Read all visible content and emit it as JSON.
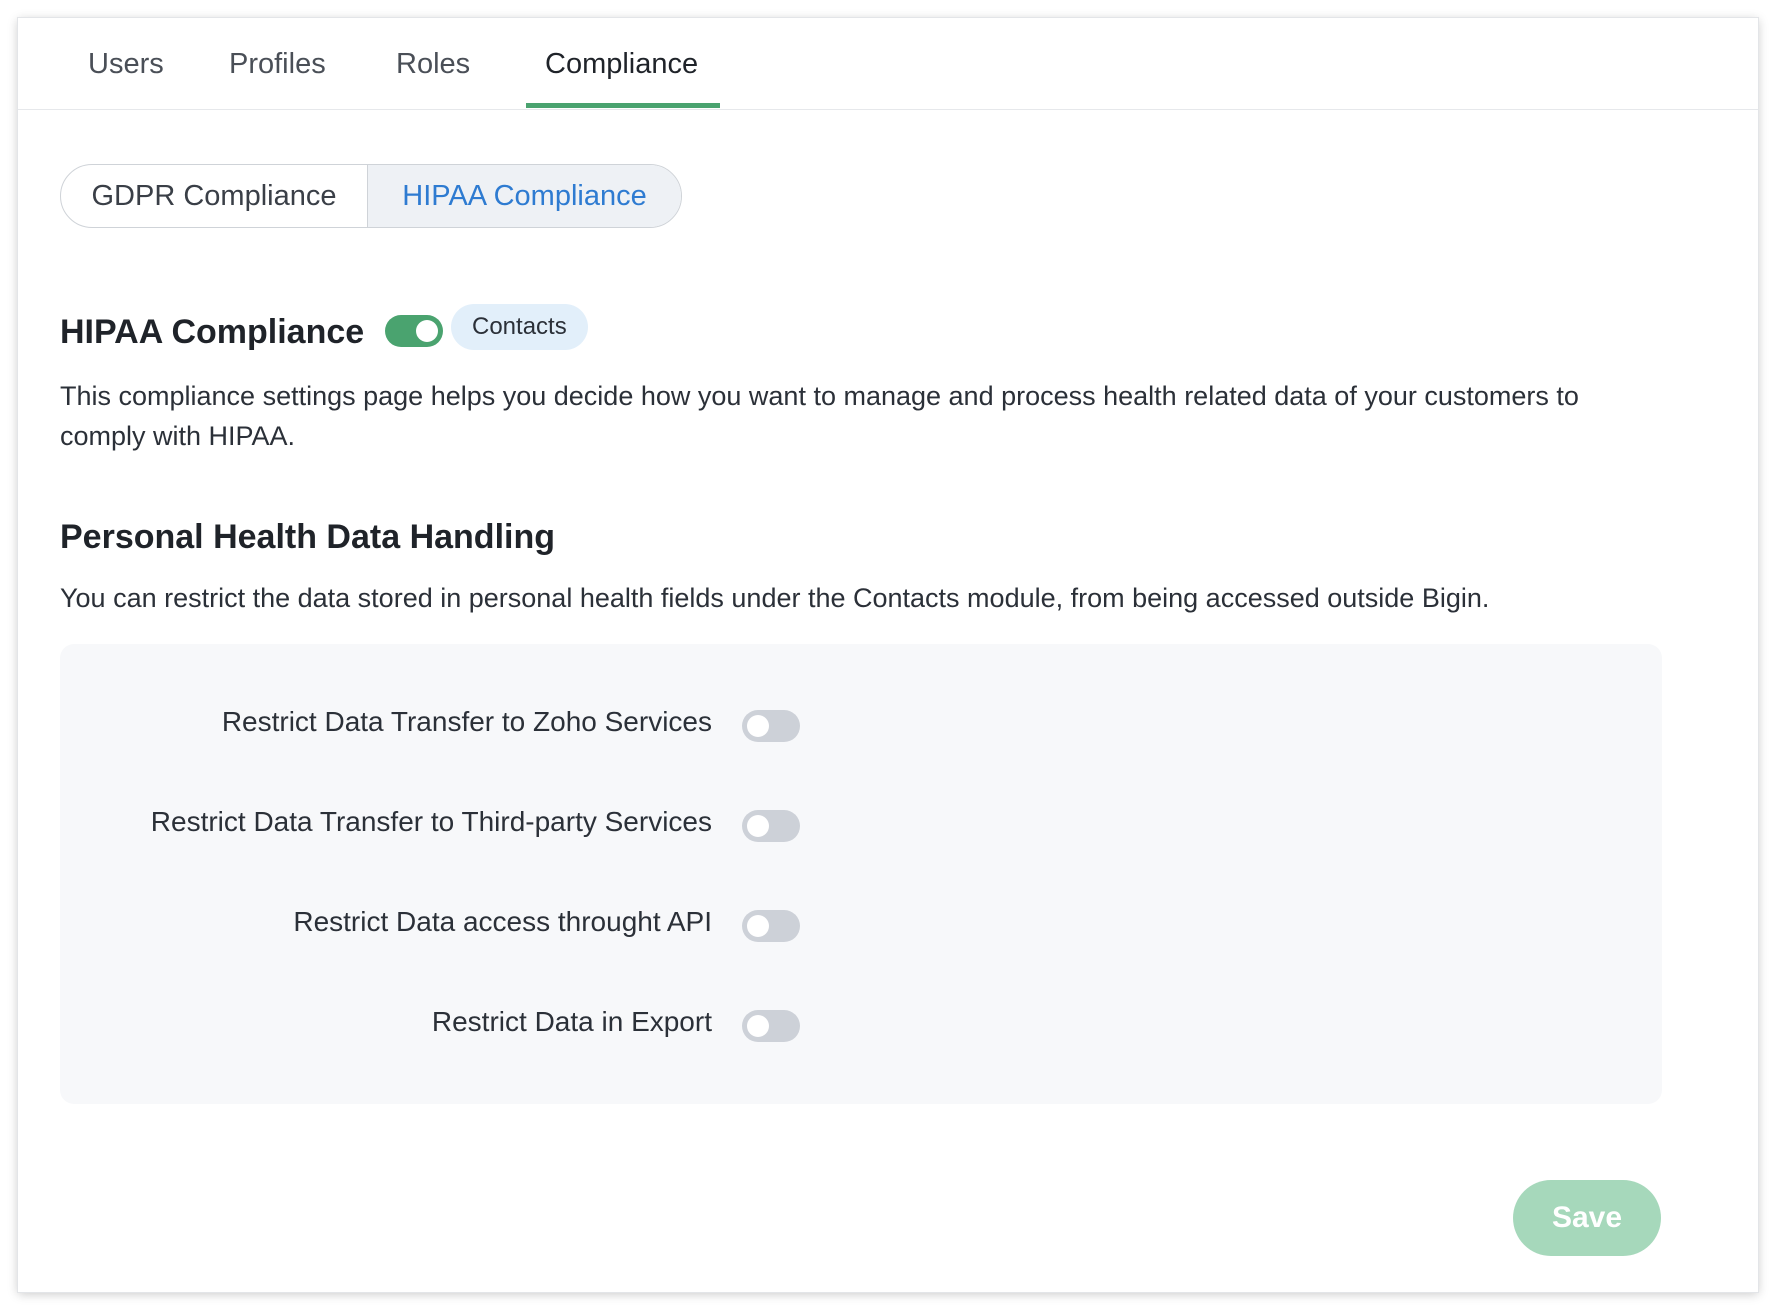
{
  "tabs": [
    {
      "label": "Users"
    },
    {
      "label": "Profiles"
    },
    {
      "label": "Roles"
    },
    {
      "label": "Compliance"
    }
  ],
  "active_tab": "Compliance",
  "segments": {
    "gdpr_label": "GDPR Compliance",
    "hipaa_label": "HIPAA Compliance",
    "selected": "HIPAA Compliance"
  },
  "hipaa": {
    "title": "HIPAA Compliance",
    "enabled": true,
    "module_badge": "Contacts",
    "description": "This compliance settings page helps you decide how you want to manage and process health related data of your customers to comply with HIPAA."
  },
  "personal_health": {
    "title": "Personal Health Data Handling",
    "description": "You can restrict the data stored in personal health fields under the Contacts module, from being accessed outside Bigin.",
    "options": [
      {
        "label": "Restrict Data Transfer to Zoho Services",
        "enabled": false
      },
      {
        "label": "Restrict Data Transfer to Third-party Services",
        "enabled": false
      },
      {
        "label": "Restrict Data access throught API",
        "enabled": false
      },
      {
        "label": "Restrict Data in Export",
        "enabled": false
      }
    ]
  },
  "actions": {
    "save_label": "Save"
  },
  "colors": {
    "accent_green": "#4aa36f",
    "link_blue": "#2e7bd1",
    "save_disabled": "#a6d8bb",
    "badge_bg": "#e2effa"
  }
}
